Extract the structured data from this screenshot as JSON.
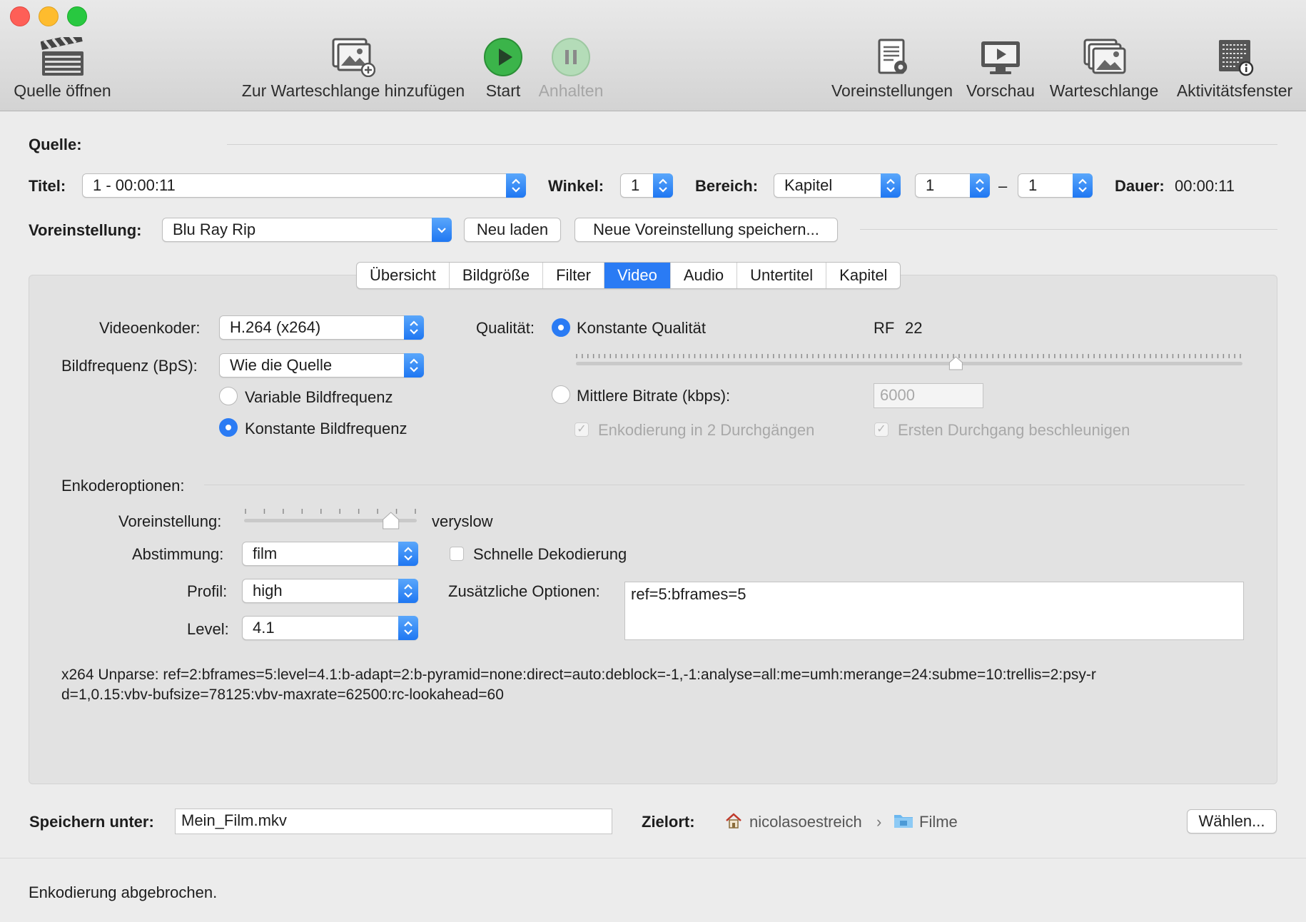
{
  "toolbar": {
    "open_source": "Quelle öffnen",
    "add_queue": "Zur Warteschlange hinzufügen",
    "start": "Start",
    "pause": "Anhalten",
    "presets": "Voreinstellungen",
    "preview": "Vorschau",
    "queue": "Warteschlange",
    "activity": "Aktivitätsfenster"
  },
  "source": {
    "label": "Quelle:",
    "title_label": "Titel:",
    "title_value": "1 - 00:00:11",
    "angle_label": "Winkel:",
    "angle_value": "1",
    "range_label": "Bereich:",
    "range_type": "Kapitel",
    "range_from": "1",
    "range_dash": "–",
    "range_to": "1",
    "duration_label": "Dauer:",
    "duration_value": "00:00:11"
  },
  "preset": {
    "label": "Voreinstellung:",
    "value": "Blu Ray Rip",
    "reload": "Neu laden",
    "save_new": "Neue Voreinstellung speichern..."
  },
  "tabs": [
    "Übersicht",
    "Bildgröße",
    "Filter",
    "Video",
    "Audio",
    "Untertitel",
    "Kapitel"
  ],
  "video": {
    "encoder_label": "Videoenkoder:",
    "encoder_value": "H.264 (x264)",
    "fps_label": "Bildfrequenz (BpS):",
    "fps_value": "Wie die Quelle",
    "variable_fps": "Variable Bildfrequenz",
    "constant_fps": "Konstante Bildfrequenz",
    "quality_label": "Qualität:",
    "constant_quality": "Konstante Qualität",
    "rf_label": "RF",
    "rf_value": "22",
    "rf_slider_fraction": 0.57,
    "avg_bitrate": "Mittlere Bitrate (kbps):",
    "bitrate_placeholder": "6000",
    "two_pass": "Enkodierung in 2 Durchgängen",
    "turbo": "Ersten Durchgang beschleunigen"
  },
  "encoder_options": {
    "header": "Enkoderoptionen:",
    "preset_label": "Voreinstellung:",
    "preset_value": "veryslow",
    "preset_slider_fraction": 0.85,
    "tune_label": "Abstimmung:",
    "tune_value": "film",
    "fast_decode": "Schnelle Dekodierung",
    "profile_label": "Profil:",
    "profile_value": "high",
    "extra_label": "Zusätzliche Optionen:",
    "extra_value": "ref=5:bframes=5",
    "level_label": "Level:",
    "level_value": "4.1",
    "unparse_line1": "x264 Unparse: ref=2:bframes=5:level=4.1:b-adapt=2:b-pyramid=none:direct=auto:deblock=-1,-1:analyse=all:me=umh:merange=24:subme=10:trellis=2:psy-r",
    "unparse_line2": "d=1,0.15:vbv-bufsize=78125:vbv-maxrate=62500:rc-lookahead=60"
  },
  "save": {
    "label": "Speichern unter:",
    "filename": "Mein_Film.mkv",
    "dest_label": "Zielort:",
    "path_home": "nicolasoestreich",
    "path_sep": "›",
    "path_folder": "Filme",
    "choose": "Wählen..."
  },
  "status": {
    "text": "Enkodierung abgebrochen."
  },
  "colors": {
    "accent": "#2a7bf4",
    "close": "#fe5f57",
    "minimize": "#febc2e",
    "zoom": "#28c840",
    "start": "#34b233"
  }
}
